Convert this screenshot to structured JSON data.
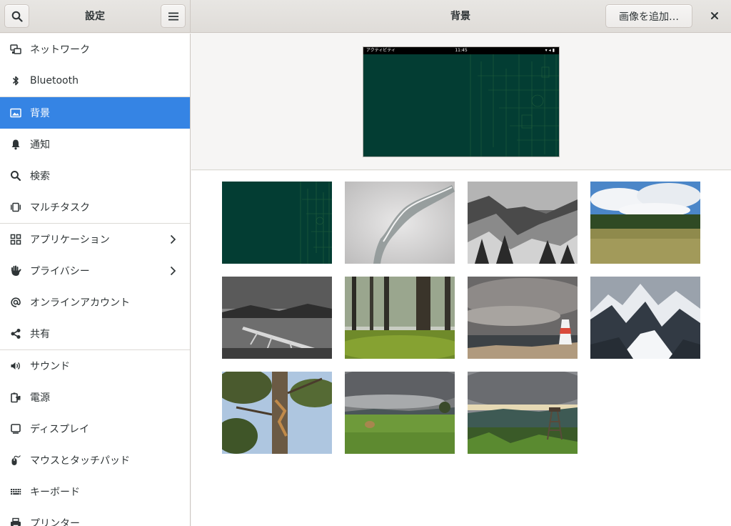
{
  "sidebar": {
    "title": "設定",
    "items": [
      {
        "label": "ネットワーク",
        "icon": "network-icon"
      },
      {
        "label": "Bluetooth",
        "icon": "bluetooth-icon"
      },
      {
        "label": "背景",
        "icon": "background-icon",
        "active": true
      },
      {
        "label": "通知",
        "icon": "bell-icon"
      },
      {
        "label": "検索",
        "icon": "search-icon"
      },
      {
        "label": "マルチタスク",
        "icon": "multitasking-icon"
      },
      {
        "label": "アプリケーション",
        "icon": "apps-grid-icon",
        "chevron": true
      },
      {
        "label": "プライバシー",
        "icon": "hand-icon",
        "chevron": true
      },
      {
        "label": "オンラインアカウント",
        "icon": "at-sign-icon"
      },
      {
        "label": "共有",
        "icon": "share-icon"
      },
      {
        "label": "サウンド",
        "icon": "speaker-icon"
      },
      {
        "label": "電源",
        "icon": "power-icon"
      },
      {
        "label": "ディスプレイ",
        "icon": "display-icon"
      },
      {
        "label": "マウスとタッチパッド",
        "icon": "mouse-icon"
      },
      {
        "label": "キーボード",
        "icon": "keyboard-icon"
      },
      {
        "label": "プリンター",
        "icon": "printer-icon"
      }
    ]
  },
  "header": {
    "title": "背景",
    "add_button": "画像を追加…",
    "close_icon": "close-icon"
  },
  "preview": {
    "activities": "アクティビティ",
    "clock": "11:45"
  },
  "wallpapers": [
    "green-circuit",
    "water-splash",
    "snowy-forest",
    "meadow-clouds",
    "lake-driftwood",
    "forest-moss",
    "storm-lighthouse",
    "snowy-valley",
    "pine-tree",
    "hay-field",
    "hill-tower"
  ],
  "colors": {
    "accent": "#3584e4",
    "wallpaper_green": "#033d33"
  }
}
